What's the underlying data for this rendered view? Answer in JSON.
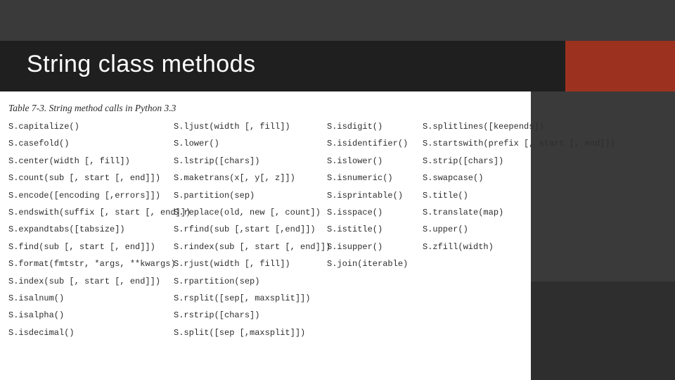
{
  "heading": "String class methods",
  "caption": "Table 7-3. String method calls in Python 3.3",
  "columns": {
    "col1": [
      "S.capitalize()",
      "S.casefold()",
      "S.center(width [, fill])",
      "S.count(sub [, start [, end]])",
      "S.encode([encoding [,errors]])",
      "S.endswith(suffix [, start [, end]])",
      "S.expandtabs([tabsize])",
      "S.find(sub [, start [, end]])",
      "S.format(fmtstr, *args, **kwargs)",
      "S.index(sub [, start [, end]])",
      "S.isalnum()",
      "S.isalpha()",
      "S.isdecimal()"
    ],
    "col2": [
      "S.ljust(width [, fill])",
      "S.lower()",
      "S.lstrip([chars])",
      "S.maketrans(x[, y[, z]])",
      "S.partition(sep)",
      "S.replace(old, new [, count])",
      "S.rfind(sub [,start [,end]])",
      "S.rindex(sub [, start [, end]])",
      "S.rjust(width [, fill])",
      "S.rpartition(sep)",
      "S.rsplit([sep[, maxsplit]])",
      "S.rstrip([chars])",
      "S.split([sep [,maxsplit]])"
    ],
    "col3": [
      "S.isdigit()",
      "S.isidentifier()",
      "S.islower()",
      "S.isnumeric()",
      "S.isprintable()",
      "S.isspace()",
      "S.istitle()",
      "S.isupper()",
      "S.join(iterable)"
    ],
    "col4": [
      "S.splitlines([keepends])",
      "S.startswith(prefix [, start [, end]])",
      "S.strip([chars])",
      "S.swapcase()",
      "S.title()",
      "S.translate(map)",
      "S.upper()",
      "S.zfill(width)"
    ]
  }
}
